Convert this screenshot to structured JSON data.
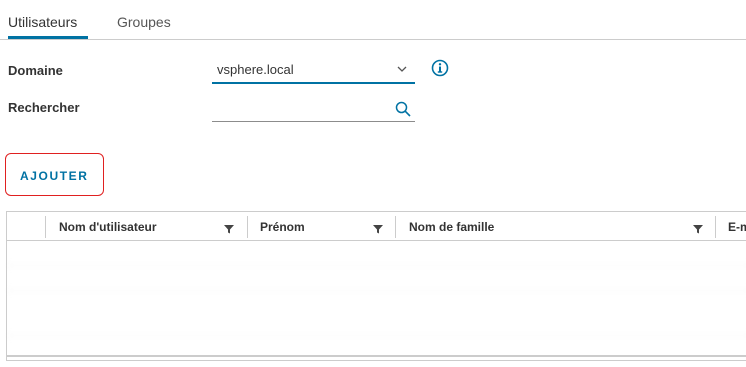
{
  "tabs": [
    {
      "label": "Utilisateurs",
      "active": true
    },
    {
      "label": "Groupes",
      "active": false
    }
  ],
  "form": {
    "domain_label": "Domaine",
    "domain_value": "vsphere.local",
    "search_label": "Rechercher",
    "search_value": ""
  },
  "toolbar": {
    "add_label": "AJOUTER"
  },
  "grid": {
    "columns": [
      "Nom d'utilisateur",
      "Prénom",
      "Nom de famille",
      "E-m"
    ],
    "rows": [
      [
        "",
        "",
        "",
        ""
      ],
      [
        "",
        "",
        "",
        ""
      ],
      [
        "",
        "",
        "",
        ""
      ],
      [
        "",
        "",
        "",
        ""
      ]
    ]
  },
  "colors": {
    "accent": "#0072a3",
    "highlight": "#e02020",
    "border": "#cccccc"
  }
}
